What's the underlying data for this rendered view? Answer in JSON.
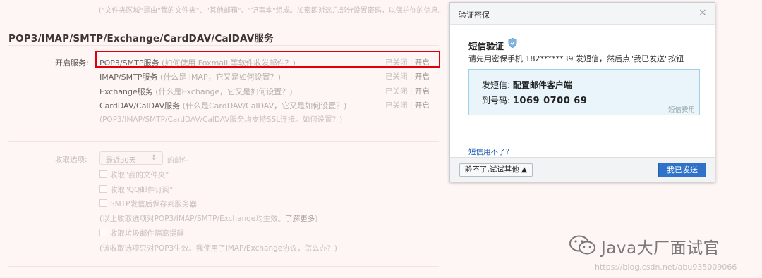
{
  "settings": {
    "top_note": "(\"文件夹区域\"是由\"我的文件夹\"、\"其他邮箱\"、\"记事本\"组成。加密即对这几部分设置密码，以保护你的信息。",
    "section_title": "POP3/IMAP/SMTP/Exchange/CardDAV/CalDAV服务",
    "service_label": "开启服务:",
    "services": [
      {
        "name": "POP3/SMTP服务",
        "hint": "(如何使用 Foxmail 等软件收发邮件？)",
        "status_off": "已关闭",
        "sep": "|",
        "status_on": "开启"
      },
      {
        "name": "IMAP/SMTP服务",
        "hint": "(什么是 IMAP，它又是如何设置？)",
        "status_off": "已关闭",
        "sep": "|",
        "status_on": "开启"
      },
      {
        "name": "Exchange服务",
        "hint": "(什么是Exchange，它又是如何设置？)",
        "status_off": "已关闭",
        "sep": "|",
        "status_on": "开启"
      },
      {
        "name": "CardDAV/CalDAV服务",
        "hint": "(什么是CardDAV/CalDAV，它又是如何设置？)",
        "status_off": "已关闭",
        "sep": "|",
        "status_on": "开启"
      }
    ],
    "ssl_note": "(POP3/IMAP/SMTP/CardDAV/CalDAV服务均支持SSL连接。如何设置？)",
    "receive_label": "收取选项:",
    "receive_select": "最近30天",
    "receive_suffix": "的邮件",
    "checks": [
      "收取\"我的文件夹\"",
      "收取\"QQ邮件订阅\"",
      "SMTP发信后保存到服务器"
    ],
    "note1_prefix": "(以上收取选项对POP3/IMAP/SMTP/Exchange均生效。",
    "note1_link": "了解更多",
    "note1_suffix": ")",
    "check_spam": "收取垃圾邮件隔离提醒",
    "note2": "(该收取选项只对POP3生效。我使用了IMAP/Exchange协议，怎么办？)"
  },
  "dialog": {
    "title": "验证密保",
    "close": "×",
    "sms_title": "短信验证",
    "instruction": "请先用密保手机 182******39 发短信，然后点\"我已发送\"按钮",
    "send_prefix": "发短信:",
    "send_text": "配置邮件客户端",
    "to_prefix": "到号码:",
    "to_number": "1069 0700 69",
    "fee": "短信费用",
    "unavailable": "短信用不了?",
    "other_button": "验不了,试试其他 ▲",
    "sent_button": "我已发送"
  },
  "watermark": {
    "text": "Java大厂面试官",
    "url": "https://blog.csdn.net/abu935009066"
  },
  "colors": {
    "highlight": "#e0000b",
    "primary_button": "#2e72c9",
    "link": "#1e5fb4",
    "sms_box_bg": "#e9f4fb"
  }
}
